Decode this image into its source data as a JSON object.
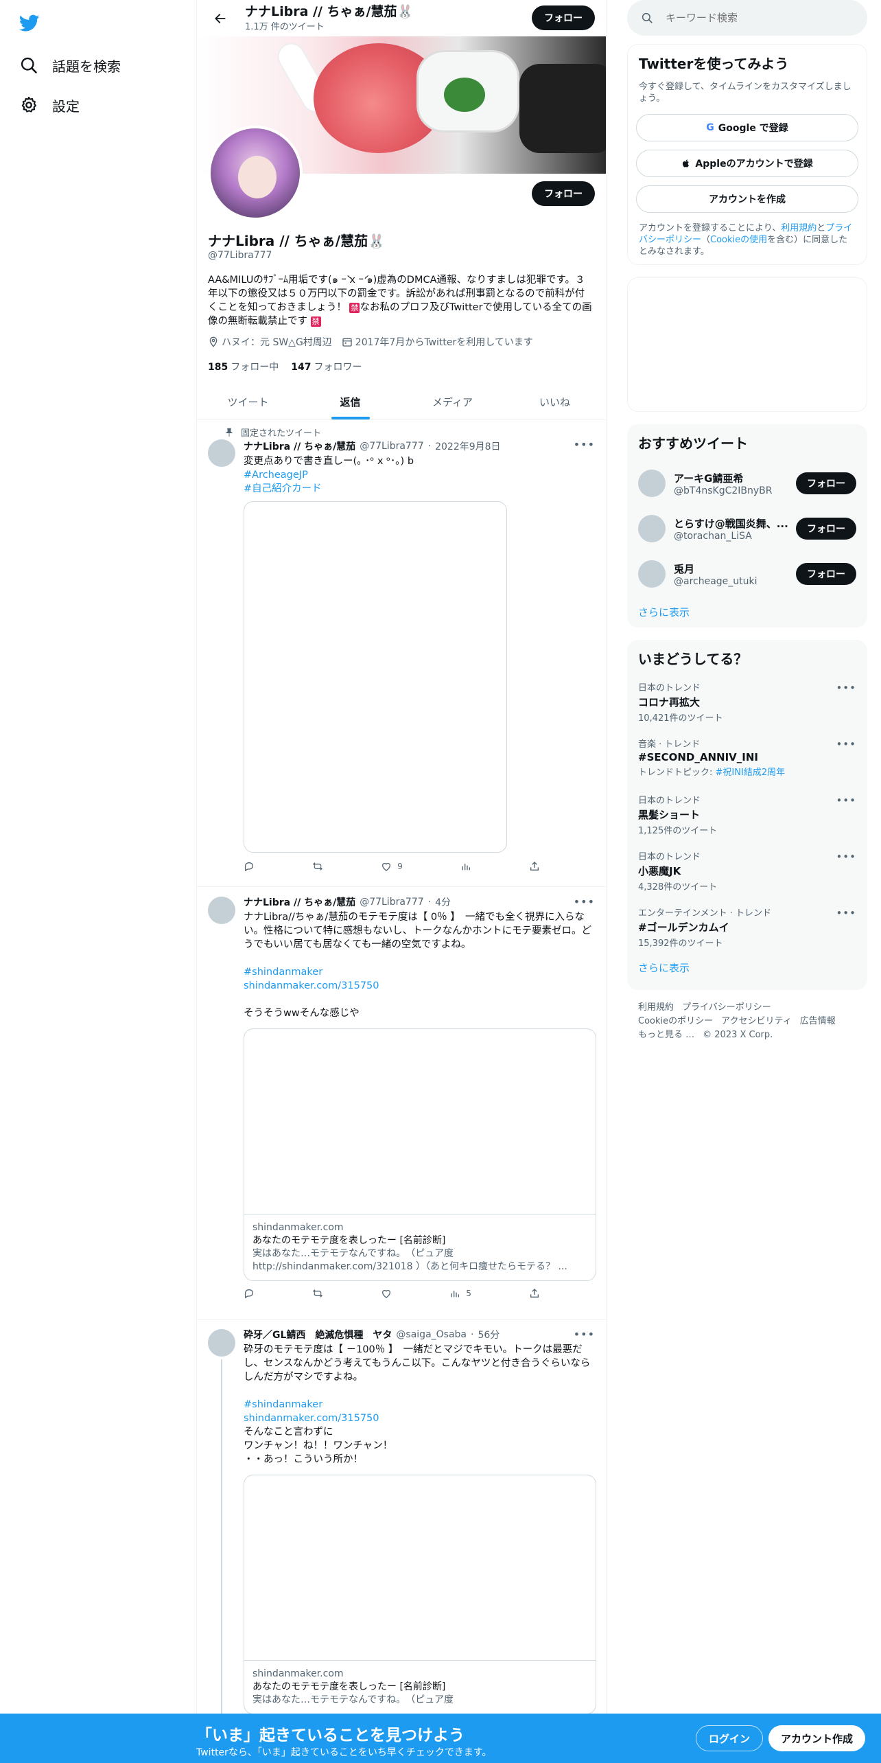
{
  "nav": {
    "explore_label": "話題を検索",
    "settings_label": "設定"
  },
  "header": {
    "name": "ナナLibra // ちゃぁ/慧茄🐰",
    "tweet_count": "1.1万 件のツイート",
    "follow_label": "フォロー"
  },
  "profile": {
    "name": "ナナLibra // ちゃぁ/慧茄🐰",
    "handle": "@77Libra777",
    "follow_label": "フォロー",
    "bio_1": "AA&MILUのｻﾌﾞｰﾑ用垢です(๑ ｰ̀ x ｰ́ ๑)虚為のDMCA通報、なりすましは犯罪です。３年以下の懲役又は５０万円以下の罰金です。訴訟があれば刑事罰となるので前科が付くことを知っておきましょう！",
    "ban_1": "禁",
    "bio_2": "なお私のプロフ及びTwitterで使用している全ての画像の無断転載禁止です",
    "ban_2": "禁",
    "location": "ハヌイ：元 SW△G村周辺",
    "joined": "2017年7月からTwitterを利用しています",
    "following_count": "185",
    "following_label": "フォロー中",
    "followers_count": "147",
    "followers_label": "フォロワー"
  },
  "tabs": [
    {
      "label": "ツイート"
    },
    {
      "label": "返信"
    },
    {
      "label": "メディア"
    },
    {
      "label": "いいね"
    }
  ],
  "tweets": [
    {
      "pinned_label": "固定されたツイート",
      "name": "ナナLibra // ちゃぁ/慧茄",
      "handle": "@77Libra777",
      "time": "2022年9月8日",
      "text": "変更点ありで書き直しー(｡ ･ᵒ x ᵒ･｡) b",
      "links": [
        "#ArcheageJP",
        "#自己紹介カード"
      ],
      "like_count": "9"
    },
    {
      "name": "ナナLibra // ちゃぁ/慧茄",
      "handle": "@77Libra777",
      "time": "4分",
      "text": "ナナLibra//ちゃぁ/慧茄のモテモテ度は【 0％ 】　一緒でも全く視界に入らない。性格について特に感想もないし、トークなんかホントにモテ要素ゼロ。どうでもいい居ても居なくても一緒の空気ですよね。",
      "links": [
        "#shindanmaker",
        "shindanmaker.com/315750"
      ],
      "text2": "そうそうwwそんな感じや",
      "card_domain": "shindanmaker.com",
      "card_title": "あなたのモテモテ度を表しったー [名前診断]",
      "card_desc": "実はあなた…モテモテなんですね。　（ピュア度http://shindanmaker.com/321018 ）（あと何キロ痩せたらモテる？ ...",
      "view_count": "5"
    },
    {
      "name": "砕牙／GL鯖西　絶滅危惧種　ヤタ",
      "handle": "@saiga_Osaba",
      "time": "56分",
      "text": "砕牙のモテモテ度は【 －100％ 】　一緒だとマジでキモい。トークは最悪だし、センスなんかどう考えてもうんこ以下。こんなヤツと付き合うぐらいならしんだ方がマシですよね。",
      "links": [
        "#shindanmaker",
        "shindanmaker.com/315750"
      ],
      "text2": "そんなこと言わずに\nワンチャン！ね！！ワンチャン！\n・・あっ！こういう所か！",
      "card_domain": "shindanmaker.com",
      "card_title": "あなたのモテモテ度を表しったー [名前診断]",
      "card_desc": "実はあなた…モテモテなんですね。　（ピュア度"
    }
  ],
  "search": {
    "placeholder": "キーワード検索"
  },
  "signup": {
    "title": "Twitterを使ってみよう",
    "sub": "今すぐ登録して、タイムラインをカスタマイズしましょう。",
    "google": "Google で登録",
    "apple": "Appleのアカウントで登録",
    "create": "アカウントを作成",
    "legal_1": "アカウントを登録することにより、",
    "terms": "利用規約",
    "legal_and": "と",
    "privacy": "プライバシーポリシー",
    "legal_paren": "（",
    "cookie": "Cookieの使用",
    "legal_2": "を含む）に同意したとみなされます。"
  },
  "recommended": {
    "title": "おすすめツイート",
    "users": [
      {
        "name": "アーキG鯖亜希",
        "handle": "@bT4nsKgC2IBnyBR"
      },
      {
        "name": "とらすけ@戦国炎舞、...",
        "handle": "@torachan_LiSA"
      },
      {
        "name": "兎月",
        "handle": "@archeage_utuki"
      }
    ],
    "follow_label": "フォロー",
    "show_more": "さらに表示"
  },
  "trends": {
    "title": "いまどうしてる？",
    "items": [
      {
        "category": "日本のトレンド",
        "name": "コロナ再拡大",
        "count": "10,421件のツイート"
      },
      {
        "category": "音楽 · トレンド",
        "name": "#SECOND_ANNIV_INI",
        "topic_label": "トレンドトピック:",
        "topic": "#祝INI結成2周年"
      },
      {
        "category": "日本のトレンド",
        "name": "黒髪ショート",
        "count": "1,125件のツイート"
      },
      {
        "category": "日本のトレンド",
        "name": "小悪魔JK",
        "count": "4,328件のツイート"
      },
      {
        "category": "エンターテインメント · トレンド",
        "name": "#ゴールデンカムイ",
        "count": "15,392件のツイート"
      }
    ],
    "show_more": "さらに表示"
  },
  "footer": {
    "links": [
      "利用規約",
      "プライバシーポリシー",
      "Cookieのポリシー",
      "アクセシビリティ",
      "広告情報",
      "もっと見る …"
    ],
    "copyright": "© 2023 X Corp."
  },
  "bottombar": {
    "title": "「いま」起きていることを見つけよう",
    "sub": "Twitterなら、「いま」起きていることをいち早くチェックできます。",
    "login": "ログイン",
    "signup": "アカウント作成"
  },
  "colors": {
    "accent": "#1d9bf0",
    "text": "#0f1419",
    "muted": "#536471"
  }
}
